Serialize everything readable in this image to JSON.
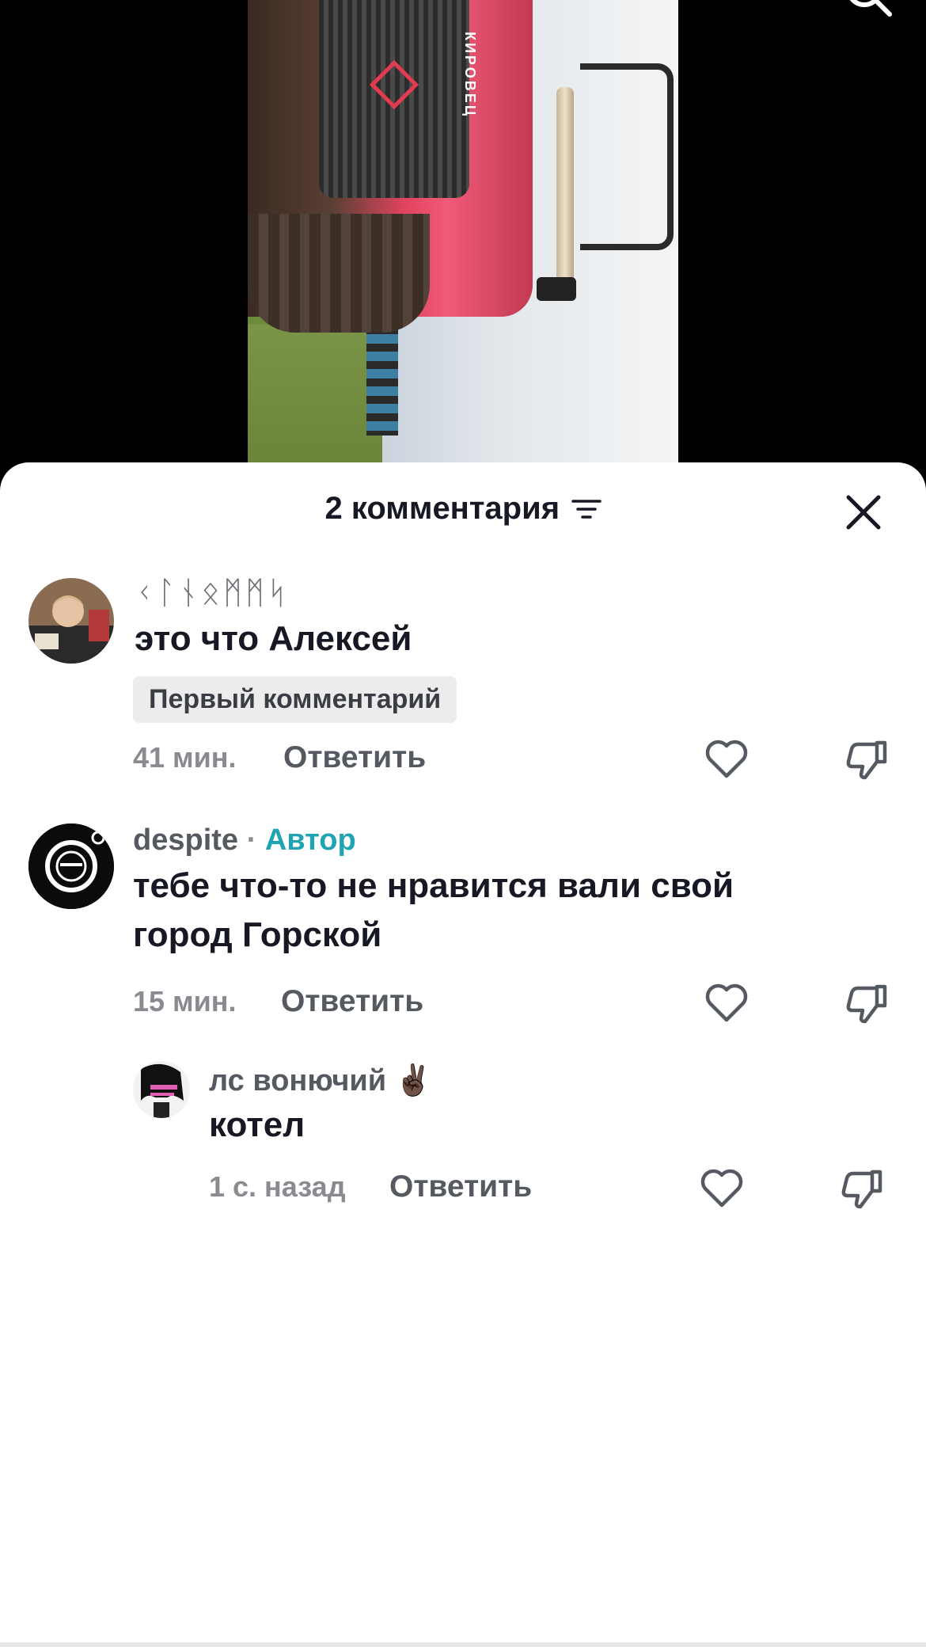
{
  "video": {
    "brand_text": "КИРОВЕЦ"
  },
  "comments_sheet": {
    "title": "2 комментария",
    "comments": [
      {
        "username": "ᚲᛚᚾᛟᛗᛗᛋ",
        "text": "это что Алексей",
        "badge": "Первый комментарий",
        "time": "41 мин.",
        "reply_label": "Ответить"
      },
      {
        "username": "despite",
        "separator": "·",
        "author_label": "Автор",
        "text": "тебе что-то не нравится вали свой город Горской",
        "time": "15 мин.",
        "reply_label": "Ответить"
      }
    ],
    "replies": [
      {
        "username": "лс вонючий",
        "emoji": "✌🏿",
        "text": "котел",
        "time": "1 с. назад",
        "reply_label": "Ответить"
      }
    ]
  },
  "colors": {
    "accent_author": "#20a4b3",
    "text_primary": "#161823",
    "text_secondary": "#8a8b91"
  },
  "icons": [
    "search-icon",
    "sort-icon",
    "close-icon",
    "heart-icon",
    "dislike-icon"
  ]
}
